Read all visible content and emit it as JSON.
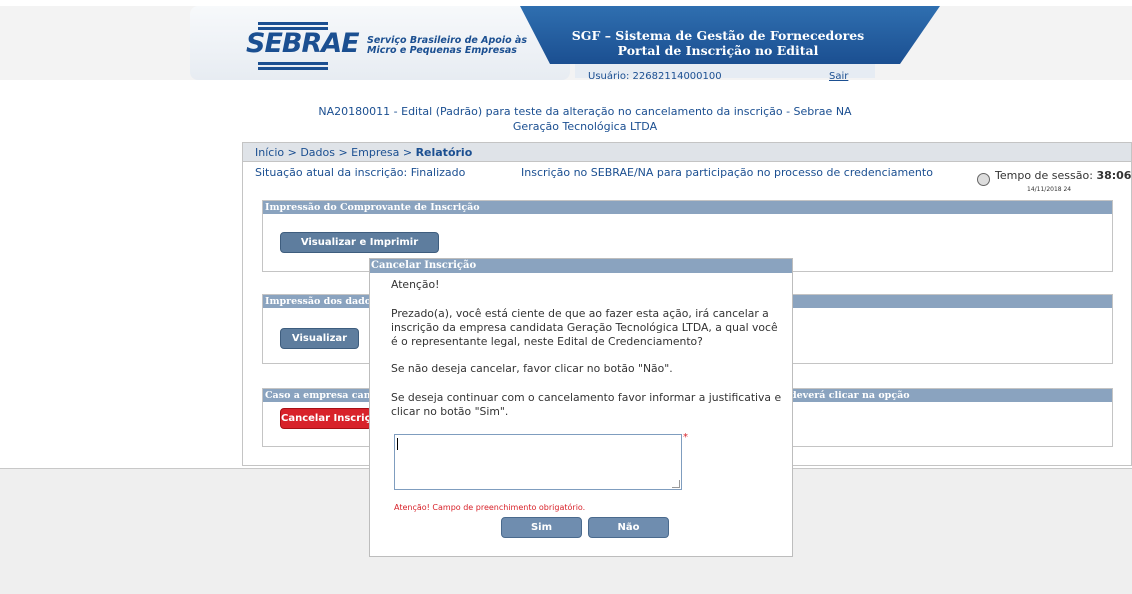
{
  "header": {
    "logo_text": "SEBRAE",
    "logo_subtitle_line1": "Serviço Brasileiro de Apoio às",
    "logo_subtitle_line2": "Micro e Pequenas Empresas",
    "system_title": "SGF – Sistema de Gestão de Fornecedores",
    "portal_title": "Portal de Inscrição no Edital",
    "user_label": "Usuário: 22682114000100",
    "logout_label": "Sair"
  },
  "edital": {
    "title": "NA20180011 - Edital (Padrão) para teste da alteração no cancelamento da inscrição - Sebrae NA",
    "company": "Geração Tecnológica LTDA"
  },
  "breadcrumb": {
    "path": "Início > Dados > Empresa > ",
    "current": "Relatório"
  },
  "status": {
    "label": "Situação atual da inscrição: Finalizado",
    "description": "Inscrição no SEBRAE/NA para participação no processo de credenciamento"
  },
  "session": {
    "label": "Tempo de sessão:",
    "time": "38:06",
    "timestamp": "14/11/2018 24"
  },
  "sections": [
    {
      "title": "Impressão do Comprovante de Inscrição",
      "button": "Visualizar e Imprimir Inscrição"
    },
    {
      "title": "Impressão dos dados d",
      "button": "Visualizar"
    },
    {
      "title": "Caso a empresa candid",
      "title_tail": "deverá clicar na opção",
      "button": "Cancelar Inscriçã"
    }
  ],
  "modal": {
    "title": "Cancelar Inscrição",
    "attention": "Atenção!",
    "paragraph1": "Prezado(a), você está ciente de que ao fazer esta ação, irá cancelar a inscrição da empresa candidata Geração Tecnológica LTDA, a qual você é o representante legal, neste Edital de Credenciamento?",
    "paragraph2": "Se não deseja cancelar, favor clicar no botão \"Não\".",
    "paragraph3": "Se deseja continuar com o cancelamento favor informar a justificativa e clicar no botão \"Sim\".",
    "justification_value": "",
    "required_mark": "*",
    "warning": "Atenção! Campo de preenchimento obrigatório.",
    "yes_label": "Sim",
    "no_label": "Não"
  },
  "colors": {
    "brand_blue": "#1b4f91",
    "panel_header": "#8aa3bf",
    "danger": "#d8222a"
  }
}
